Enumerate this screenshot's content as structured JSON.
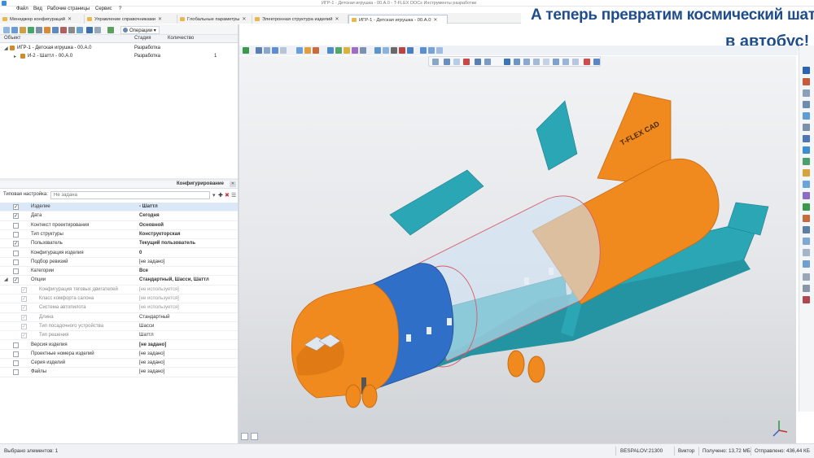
{
  "window": {
    "title": "ИГР-1 - Детская игрушка - 00.А.0 - T-FLEX DOCs Инструменты разработки"
  },
  "menu": [
    "Файл",
    "Вид",
    "Рабочие страницы",
    "Сервис",
    "?"
  ],
  "tabs": [
    {
      "label": "Менеджер конфигураций",
      "active": false
    },
    {
      "label": "Управление справочниками",
      "active": false
    },
    {
      "label": "Глобальные параметры",
      "active": false
    },
    {
      "label": "Электронная структура изделий",
      "active": false
    },
    {
      "label": "ИГР-1 - Детская игрушка - 00.А.0",
      "active": true
    }
  ],
  "overlay": {
    "line1": "А теперь превратим космический шаттл",
    "line2": "в автобус!"
  },
  "toolbar": {
    "operations_label": "Операции"
  },
  "tree": {
    "headers": {
      "object": "Объект",
      "stage": "Стадия",
      "quantity": "Количество"
    },
    "rows": [
      {
        "name": "ИГР-1 - Детская игрушка - 00.А.0",
        "stage": "Разработка",
        "qty": ""
      },
      {
        "name": "И-2 - Шаттл - 00.А.0",
        "stage": "Разработка",
        "qty": "1"
      }
    ]
  },
  "config": {
    "title": "Конфигурирование",
    "preset_label": "Типовая настройка:",
    "preset_placeholder": "Не задана",
    "rows": [
      {
        "name": "Изделие",
        "value": "- Шаттл",
        "check": "✓",
        "bold": true,
        "selected": true
      },
      {
        "name": "Дата",
        "value": "Сегодня",
        "check": "✓",
        "bold": true
      },
      {
        "name": "Контекст проектирования",
        "value": "Основной",
        "check": "",
        "bold": true
      },
      {
        "name": "Тип структуры",
        "value": "Конструкторская",
        "check": "",
        "bold": true
      },
      {
        "name": "Пользователь",
        "value": "Текущий пользователь",
        "check": "✓",
        "bold": true
      },
      {
        "name": "Конфигурация изделия",
        "value": "0",
        "check": "",
        "bold": true
      },
      {
        "name": "Подбор ревизий",
        "value": "[не задано]",
        "check": "",
        "bold": false
      },
      {
        "name": "Категории",
        "value": "Все",
        "check": "",
        "bold": true
      },
      {
        "name": "Опции",
        "value": "Стандартный, Шасси, Шаттл",
        "check": "✓",
        "bold": true,
        "expand": true
      },
      {
        "name": "Конфигурация тяговых двигателей",
        "value": "[не используется]",
        "check": "✓",
        "indent": true,
        "dim": true
      },
      {
        "name": "Класс комфорта салона",
        "value": "[не используется]",
        "check": "✓",
        "indent": true,
        "dim": true
      },
      {
        "name": "Система автопилота",
        "value": "[не используется]",
        "check": "✓",
        "indent": true,
        "dim": true
      },
      {
        "name": "Длина",
        "value": "Стандартный",
        "check": "✓",
        "indent": true
      },
      {
        "name": "Тип посадочного устройства",
        "value": "Шасси",
        "check": "✓",
        "indent": true
      },
      {
        "name": "Тип решения",
        "value": "Шаттл",
        "check": "✓",
        "indent": true
      },
      {
        "name": "Версия изделия",
        "value": "[не задано]",
        "check": "",
        "bold": true
      },
      {
        "name": "Проектные номера изделий",
        "value": "[не задано]",
        "check": ""
      },
      {
        "name": "Серия изделий",
        "value": "[не задано]",
        "check": ""
      },
      {
        "name": "Файлы",
        "value": "[не задано]",
        "check": ""
      }
    ]
  },
  "model": {
    "logo_text": "T-FLEX CAD"
  },
  "colors": {
    "body_orange": "#f08a1e",
    "wing_teal": "#2aa6b5",
    "mid_blue": "#2f6fc7",
    "accent": "#1f4d8a"
  },
  "status": {
    "selected": "Выбрано элементов: 1",
    "server": "BESPALOV:21300",
    "user": "Виктор",
    "received": "Получено: 13,72 МБ",
    "sent": "Отправлено: 436,44 КБ"
  }
}
